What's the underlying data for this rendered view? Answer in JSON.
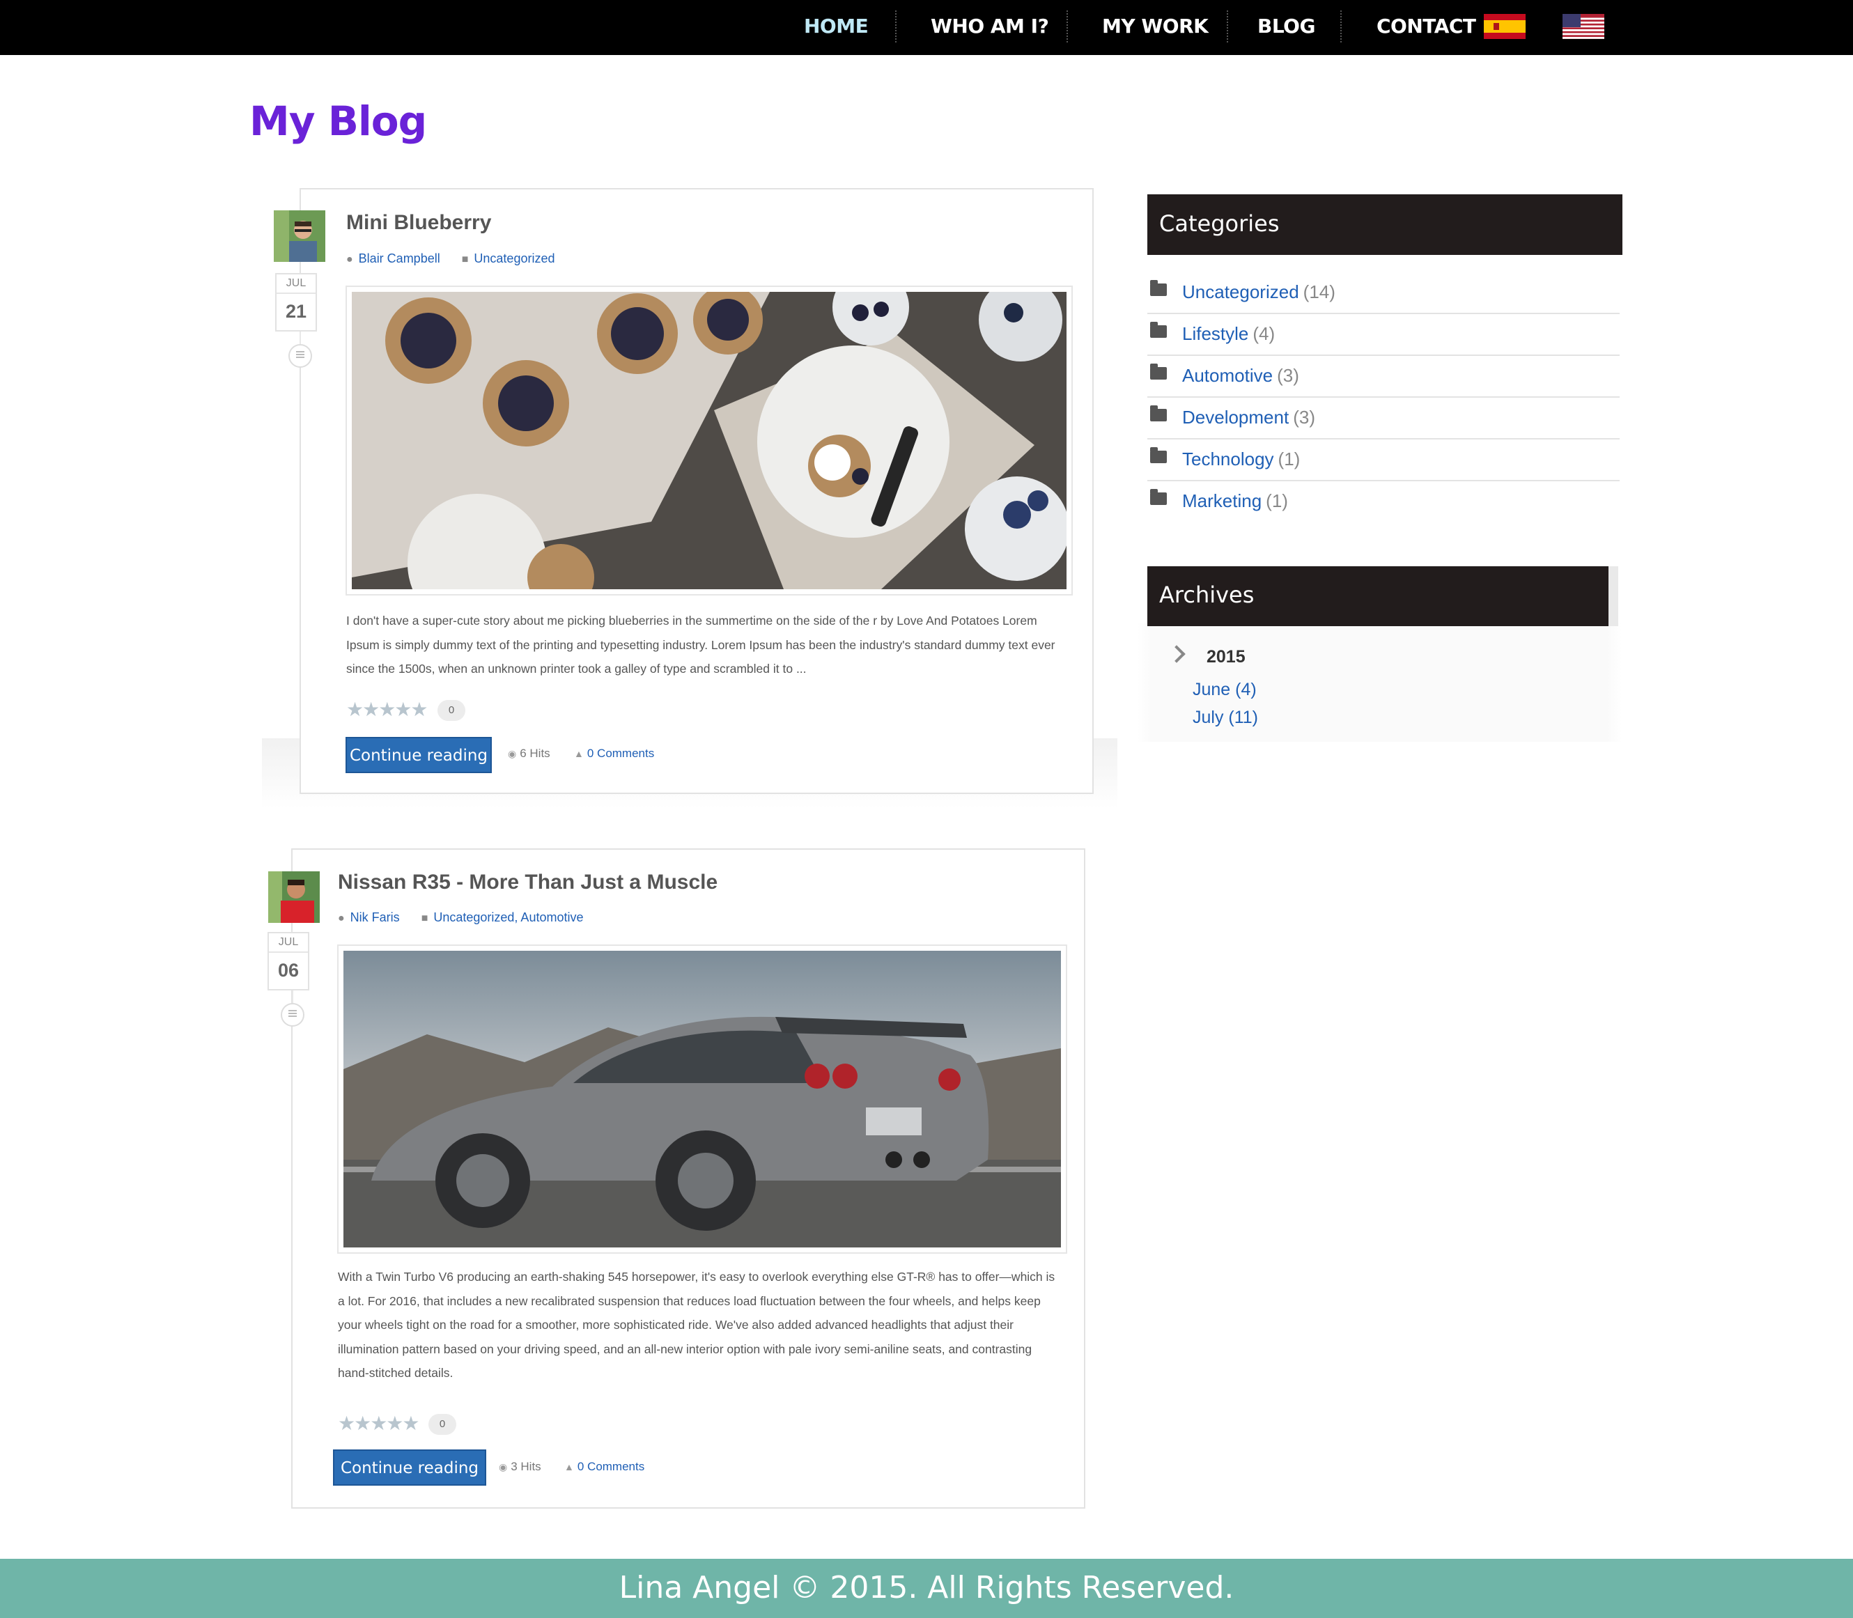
{
  "nav": {
    "items": [
      {
        "label": "HOME",
        "active": true
      },
      {
        "label": "WHO AM I?"
      },
      {
        "label": "MY WORK"
      },
      {
        "label": "BLOG"
      },
      {
        "label": "CONTACT"
      }
    ],
    "flags": [
      "spain-flag-icon",
      "us-flag-icon"
    ]
  },
  "page": {
    "title": "My Blog"
  },
  "posts": [
    {
      "title": "Mini Blueberry",
      "author": "Blair Campbell",
      "categories": "Uncategorized",
      "date_month": "JUL",
      "date_day": "21",
      "excerpt": "I don't have a super-cute story about me picking blueberries in the summertime on the side of the r by Love And Potatoes Lorem Ipsum is simply dummy text of the printing and typesetting industry. Lorem Ipsum has been the industry's standard dummy text ever since the 1500s, when an unknown printer took a galley of type and scrambled it to ...",
      "stars": "★★★★★",
      "votes": "0",
      "continue_label": "Continue reading",
      "hits": "6 Hits",
      "comments": "0 Comments"
    },
    {
      "title": "Nissan R35 - More Than Just a Muscle",
      "author": "Nik Faris",
      "categories": "Uncategorized, Automotive",
      "date_month": "JUL",
      "date_day": "06",
      "excerpt": "With a Twin Turbo V6 producing an earth-shaking 545 horsepower, it's easy to overlook everything else GT-R® has to offer—which is a lot. For 2016, that includes a new recalibrated suspension that reduces load fluctuation between the four wheels, and helps keep your wheels tight on the road for a smoother, more sophisticated ride. We've also added advanced headlights that adjust their illumination pattern based on your driving speed, and an all-new interior option with pale ivory semi-aniline seats, and contrasting hand-stitched details.",
      "stars": "★★★★★",
      "votes": "0",
      "continue_label": "Continue reading",
      "hits": "3 Hits",
      "comments": "0 Comments"
    }
  ],
  "sidebar": {
    "categories_title": "Categories",
    "categories": [
      {
        "name": "Uncategorized",
        "count": "(14)"
      },
      {
        "name": "Lifestyle",
        "count": "(4)"
      },
      {
        "name": "Automotive",
        "count": "(3)"
      },
      {
        "name": "Development",
        "count": "(3)"
      },
      {
        "name": "Technology",
        "count": "(1)"
      },
      {
        "name": "Marketing",
        "count": "(1)"
      }
    ],
    "archives_title": "Archives",
    "archive_year": "2015",
    "archive_months": [
      "June (4)",
      "July (11)"
    ]
  },
  "footer": {
    "text": "Lina Angel © 2015. All Rights Reserved."
  },
  "colors": {
    "title": "#6a22d8",
    "link": "#1f5fb5",
    "button": "#2a6db5",
    "footer": "#6fb5a8",
    "widget_head": "#221c1c"
  }
}
